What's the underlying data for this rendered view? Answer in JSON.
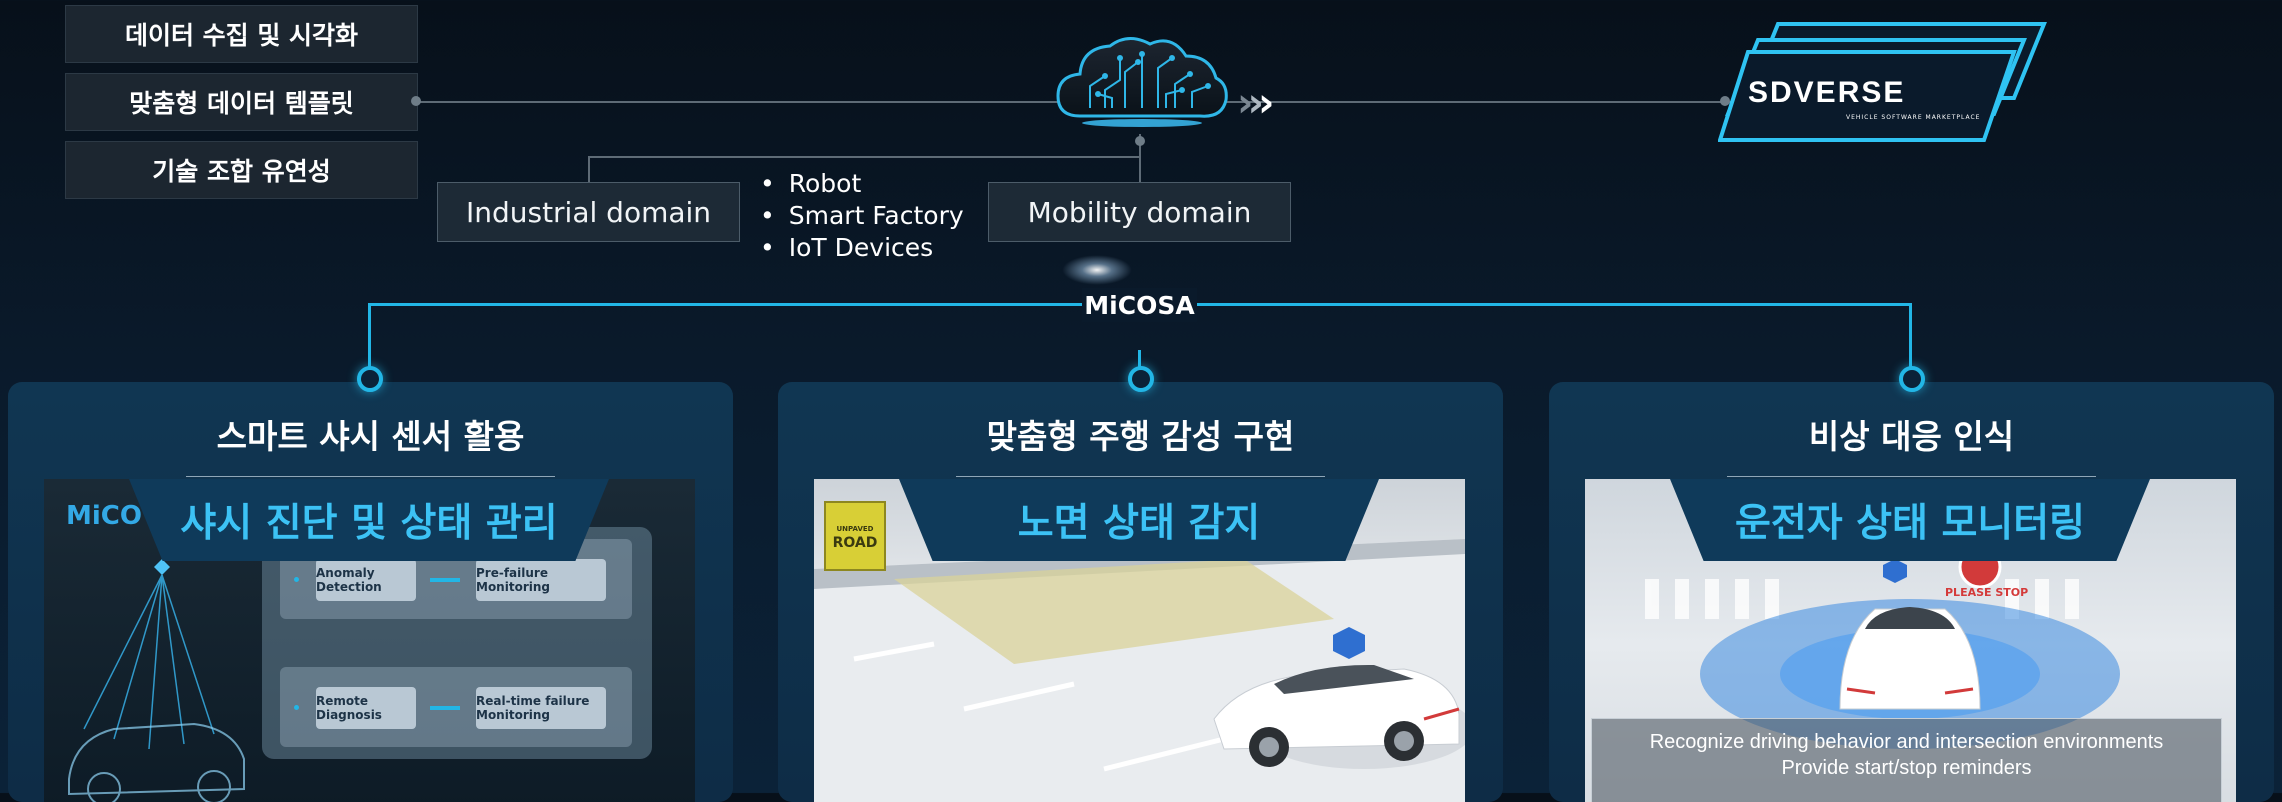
{
  "features": [
    "데이터 수집 및 시각화",
    "맞춤형 데이터 템플릿",
    "기술 조합 유연성"
  ],
  "domains": {
    "industrial": "Industrial domain",
    "mobility": "Mobility domain",
    "bullets": [
      "Robot",
      "Smart Factory",
      "IoT Devices"
    ]
  },
  "chevrons": "›››",
  "sdverse": {
    "name": "SDVERSE",
    "tagline": "VEHICLE SOFTWARE MARKETPLACE"
  },
  "hub": "MiCOSA",
  "panels": [
    {
      "title": "스마트 샤시 센서 활용",
      "banner": "샤시 진단 및 상태 관리",
      "logo": "MiCO",
      "chips": [
        "Anomaly Detection",
        "Pre-failure Monitoring",
        "Remote Diagnosis",
        "Real-time failure Monitoring"
      ]
    },
    {
      "title": "맞춤형 주행 감성 구현",
      "banner": "노면 상태 감지",
      "sign": [
        "UNPAVED",
        "ROAD"
      ]
    },
    {
      "title": "비상 대응 인식",
      "banner": "운전자 상태 모니터링",
      "stop_label": "PLEASE STOP",
      "caption": [
        "Recognize driving behavior and intersection environments",
        "Provide start/stop reminders"
      ]
    }
  ],
  "colors": {
    "accent": "#22b6e6",
    "banner_text": "#3cc2f5"
  }
}
